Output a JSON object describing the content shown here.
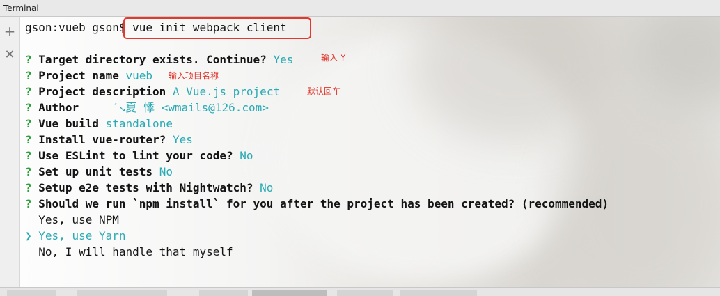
{
  "window": {
    "title": "Terminal"
  },
  "sidebar": {
    "add_icon": "plus-icon",
    "close_icon": "close-icon"
  },
  "terminal": {
    "command": {
      "prompt": "gson:vueb gson$",
      "text": " vue init webpack client"
    },
    "questions": [
      {
        "mark": "?",
        "question": "Target directory exists. Continue?",
        "answer": "Yes"
      },
      {
        "mark": "?",
        "question": "Project name",
        "answer": "vueb"
      },
      {
        "mark": "?",
        "question": "Project description",
        "answer": "A Vue.js project"
      },
      {
        "mark": "?",
        "question": "Author",
        "answer": "____ˊ↘夏 悸 <wmails@126.com>"
      },
      {
        "mark": "?",
        "question": "Vue build",
        "answer": "standalone"
      },
      {
        "mark": "?",
        "question": "Install vue-router?",
        "answer": "Yes"
      },
      {
        "mark": "?",
        "question": "Use ESLint to lint your code?",
        "answer": "No"
      },
      {
        "mark": "?",
        "question": "Set up unit tests",
        "answer": "No"
      },
      {
        "mark": "?",
        "question": "Setup e2e tests with Nightwatch?",
        "answer": "No"
      },
      {
        "mark": "?",
        "question": "Should we run `npm install` for you after the project has been created? (recommended)",
        "answer": ""
      }
    ],
    "options": [
      {
        "pointer": "",
        "label": "Yes, use NPM"
      },
      {
        "pointer": "❯",
        "label": "Yes, use Yarn"
      },
      {
        "pointer": "",
        "label": "No, I will handle that myself"
      }
    ]
  },
  "annotations": {
    "continue_note": "输入 Y",
    "name_note": "输入项目名称",
    "desc_note": "默认回车"
  },
  "colors": {
    "question_mark": "#2c9f3b",
    "answer": "#2aaab4",
    "highlight_box": "#e3382c",
    "annotation": "#e0352b"
  }
}
